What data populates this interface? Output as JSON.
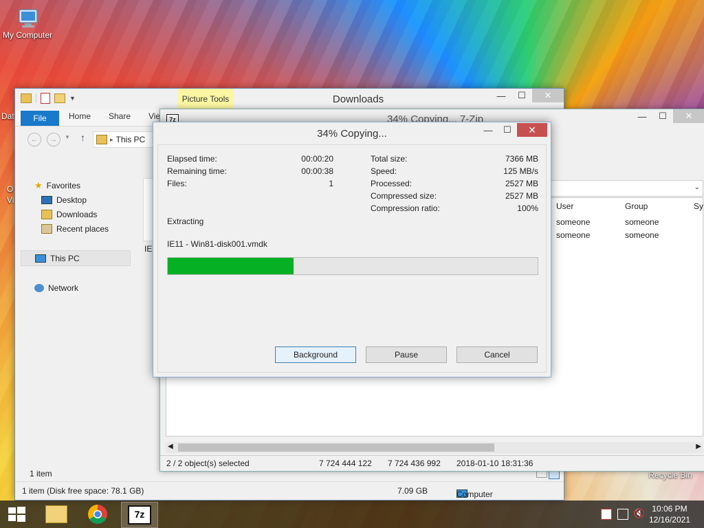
{
  "desktop": {
    "icons": {
      "my_computer": "My Computer",
      "recycle_bin": "Recycle Bin"
    },
    "partial_labels": {
      "dat": "Dat",
      "o": "O",
      "vi": "Vi"
    }
  },
  "explorer": {
    "title": "Downloads",
    "picture_tools": "Picture Tools",
    "ribbon": {
      "file": "File",
      "home": "Home",
      "share": "Share",
      "view": "Vie"
    },
    "address": "This PC",
    "nav": {
      "favorites": "Favorites",
      "desktop": "Desktop",
      "downloads": "Downloads",
      "recent": "Recent places",
      "this_pc": "This PC",
      "network": "Network"
    },
    "partial_item": "IE1",
    "status_count": "1 item",
    "bottom": {
      "free_space": "1 item (Disk free space: 78.1 GB)",
      "size": "7.09 GB",
      "location": "Computer"
    }
  },
  "filemanager": {
    "title": "34% Copying... 7-Zip",
    "columns": {
      "user": "User",
      "group": "Group",
      "sy": "Sy"
    },
    "rows": [
      {
        "user": "someone",
        "group": "someone"
      },
      {
        "user": "someone",
        "group": "someone"
      }
    ],
    "status": {
      "selected": "2 / 2 object(s) selected",
      "size1": "7 724 444 122",
      "size2": "7 724 436 992",
      "date": "2018-01-10 18:31:36"
    }
  },
  "dialog": {
    "title": "34% Copying...",
    "left": {
      "elapsed_label": "Elapsed time:",
      "elapsed_value": "00:00:20",
      "remaining_label": "Remaining time:",
      "remaining_value": "00:00:38",
      "files_label": "Files:",
      "files_value": "1"
    },
    "right": {
      "total_label": "Total size:",
      "total_value": "7366 MB",
      "speed_label": "Speed:",
      "speed_value": "125 MB/s",
      "processed_label": "Processed:",
      "processed_value": "2527 MB",
      "compressed_label": "Compressed size:",
      "compressed_value": "2527 MB",
      "ratio_label": "Compression ratio:",
      "ratio_value": "100%"
    },
    "operation": "Extracting",
    "current_file": "IE11 - Win81-disk001.vmdk",
    "progress_percent": 34,
    "buttons": {
      "background": "Background",
      "pause": "Pause",
      "cancel": "Cancel"
    }
  },
  "taskbar": {
    "time": "10:06 PM",
    "date": "12/16/2021",
    "zip_label": "7z"
  },
  "colors": {
    "progress_fill": "#06b025",
    "file_tab": "#1979ca",
    "close_button": "#c75050"
  }
}
